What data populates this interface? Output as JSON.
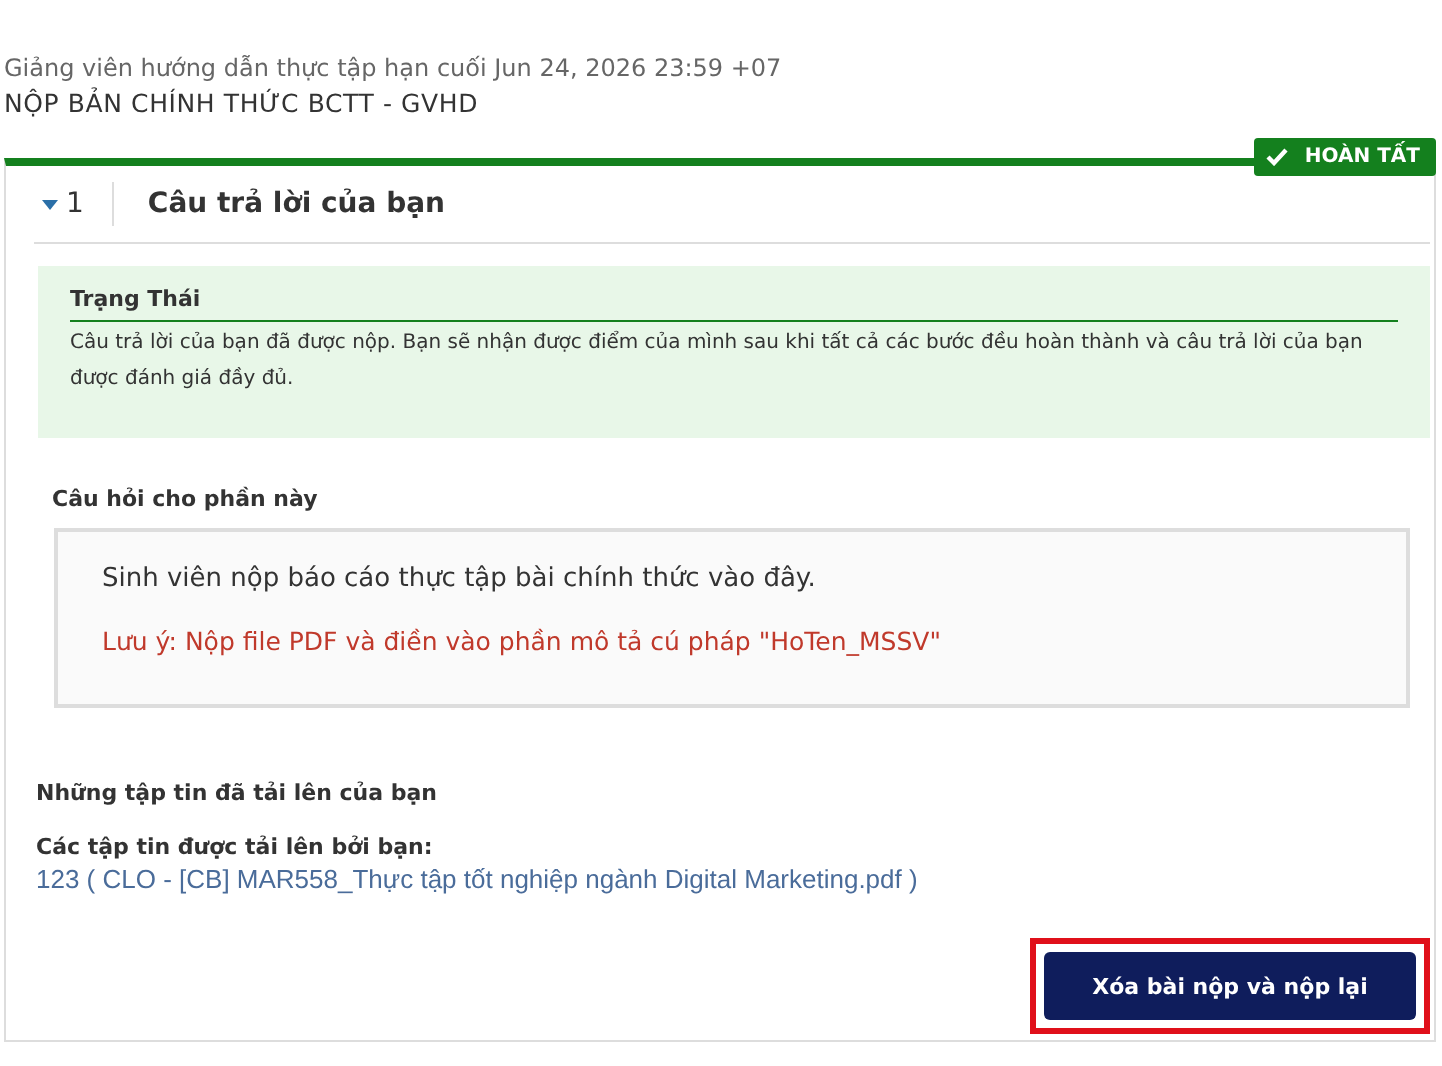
{
  "deadline": "Giảng viên hướng dẫn thực tập hạn cuối Jun 24, 2026 23:59 +07",
  "assignment_title": "NỘP BẢN CHÍNH THỨC BCTT - GVHD",
  "badge": {
    "label": "HOÀN TẤT"
  },
  "step": {
    "number": "1",
    "title": "Câu trả lời của bạn",
    "expanded": true
  },
  "status": {
    "heading": "Trạng Thái",
    "text": "Câu trả lời của bạn đã được nộp. Bạn sẽ nhận được điểm của mình sau khi tất cả các bước đều hoàn thành và câu trả lời của bạn được đánh giá đầy đủ."
  },
  "question": {
    "label": "Câu hỏi cho phần này",
    "text": "Sinh viên nộp báo cáo thực tập bài chính thức vào đây.",
    "note": "Lưu ý: Nộp file PDF và điền vào phần mô tả cú pháp \"HoTen_MSSV\""
  },
  "files": {
    "heading": "Những tập tin đã tải lên của bạn",
    "label": "Các tập tin được tải lên bởi bạn:",
    "link": "123 ( CLO - [CB] MAR558_Thực tập tốt nghiệp ngành Digital Marketing.pdf )"
  },
  "button": {
    "label": "Xóa bài nộp và nộp lại",
    "highlighted": true
  }
}
